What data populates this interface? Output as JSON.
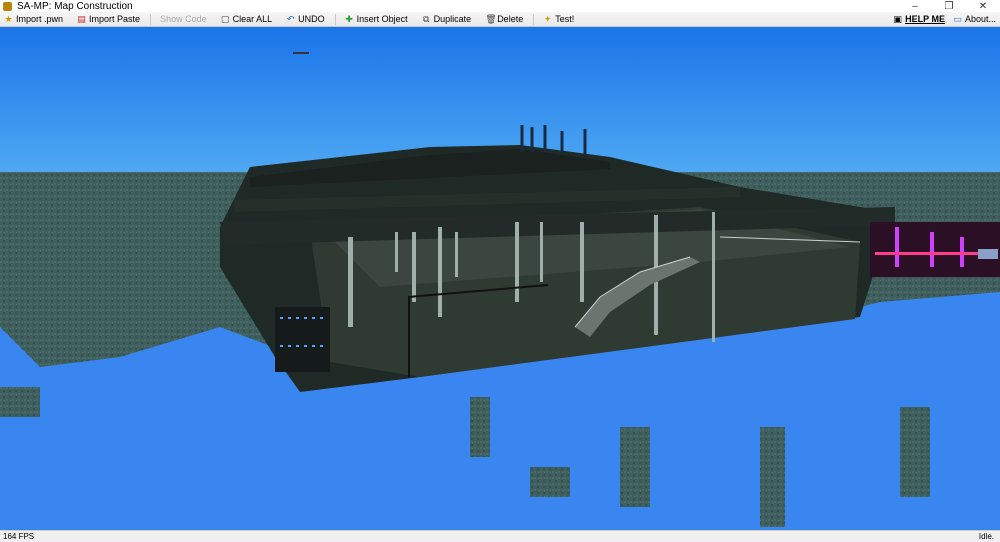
{
  "window": {
    "title": "SA-MP: Map Construction",
    "icon": "app-icon",
    "minimize": "–",
    "restore": "❐",
    "close": "✕"
  },
  "toolbar": {
    "import_pwn": "Import .pwn",
    "import_paste": "Import Paste",
    "show_code": "Show Code",
    "clear_all": "Clear ALL",
    "undo": "UNDO",
    "insert_object": "Insert Object",
    "duplicate": "Duplicate",
    "delete": "Delete",
    "test": "Test!",
    "help": "HELP ME",
    "about": "About..."
  },
  "status": {
    "fps": "164 FPS",
    "state": "Idle."
  },
  "colors": {
    "sky_top": "#1a73e6",
    "sky_bottom": "#4aa5f2",
    "water": "#3a86f0",
    "ground": "#3f5f5f"
  }
}
